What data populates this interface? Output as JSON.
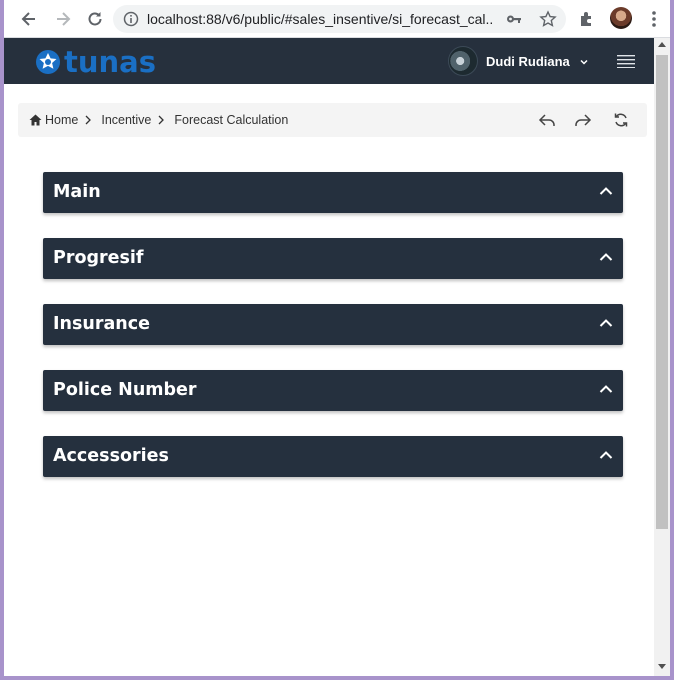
{
  "browser": {
    "url": "localhost:88/v6/public/#sales_insentive/si_forecast_cal..."
  },
  "header": {
    "logo_text": "tunas",
    "user_name": "Dudi Rudiana",
    "brand_color": "#1a6fc4",
    "bar_color": "#26303d"
  },
  "breadcrumb": {
    "items": [
      "Home",
      "Incentive",
      "Forecast Calculation"
    ]
  },
  "panels": [
    {
      "title": "Main"
    },
    {
      "title": "Progresif"
    },
    {
      "title": "Insurance"
    },
    {
      "title": "Police Number"
    },
    {
      "title": "Accessories"
    }
  ]
}
